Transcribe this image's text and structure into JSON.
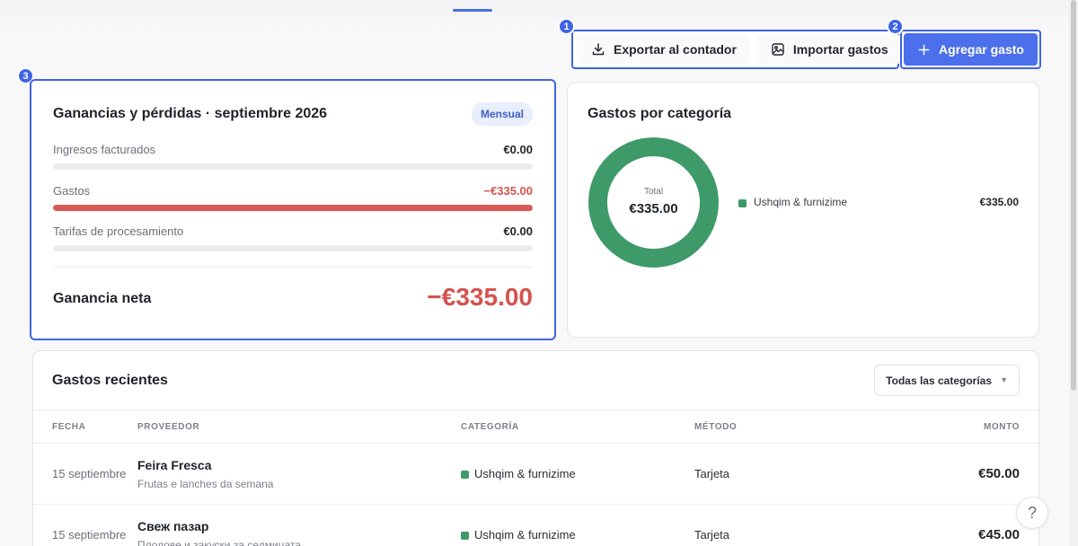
{
  "toolbar": {
    "export_label": "Exportar al contador",
    "import_label": "Importar gastos",
    "add_label": "Agregar gasto",
    "markers": [
      "1",
      "2",
      "3"
    ]
  },
  "pnl": {
    "title": "Ganancias y pérdidas · septiembre 2026",
    "period": "Mensual",
    "rows": [
      {
        "label": "Ingresos facturados",
        "value": "€0.00",
        "fill_fraction": 0
      },
      {
        "label": "Gastos",
        "value": "−€335.00",
        "fill_fraction": 1
      },
      {
        "label": "Tarifas de procesamiento",
        "value": "€0.00",
        "fill_fraction": 0
      }
    ],
    "net_label": "Ganancia neta",
    "net_value": "−€335.00"
  },
  "categories": {
    "title": "Gastos por categoría",
    "total_label": "Total",
    "total_value": "€335.00",
    "items": [
      {
        "name": "Ushqim & furnizime",
        "value": "€335.00",
        "share": 1,
        "color": "#3f9a6a"
      }
    ]
  },
  "recent": {
    "title": "Gastos recientes",
    "filter_label": "Todas las categorías",
    "columns": [
      "FECHA",
      "PROVEEDOR",
      "CATEGORÍA",
      "MÉTODO",
      "MONTO"
    ],
    "rows": [
      {
        "date": "15 septiembre",
        "vendor": "Feira Fresca",
        "desc": "Frutas e lanches da semana",
        "category": "Ushqim & furnizime",
        "method": "Tarjeta",
        "amount": "€50.00"
      },
      {
        "date": "15 septiembre",
        "vendor": "Свеж пазар",
        "desc": "Плодове и закуски за седмицата",
        "category": "Ushqim & furnizime",
        "method": "Tarjeta",
        "amount": "€45.00"
      }
    ]
  },
  "help": {
    "label": "?"
  },
  "colors": {
    "accent": "#4c70eb",
    "negative": "#d4534e",
    "category": "#3f9a6a"
  }
}
